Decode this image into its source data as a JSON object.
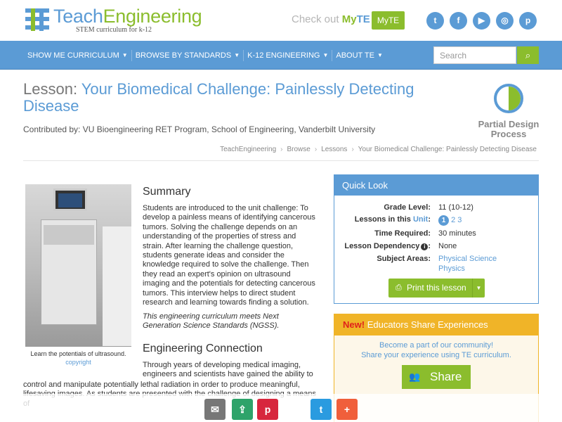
{
  "brand": {
    "name_part1": "Teach",
    "name_part2": "Engineering",
    "tagline": "STEM curriculum for k-12",
    "blue": "#5b9bd5",
    "green": "#8bbd2d"
  },
  "header": {
    "checkout_text": "Check out",
    "my": "My",
    "te": "TE",
    "myte_button": "MyTE",
    "social_icons": [
      "twitter-icon",
      "facebook-icon",
      "youtube-icon",
      "instagram-icon",
      "pinterest-icon"
    ],
    "social_glyphs": [
      "t",
      "f",
      "▶",
      "◎",
      "p"
    ]
  },
  "nav": {
    "items": [
      "SHOW ME CURRICULUM",
      "BROWSE BY STANDARDS",
      "K-12 ENGINEERING",
      "ABOUT TE"
    ],
    "search_placeholder": "Search",
    "search_glyph": "⌕"
  },
  "lesson": {
    "prefix": "Lesson:",
    "title": "Your Biomedical Challenge: Painlessly Detecting Disease",
    "contributed": "Contributed by: VU Bioengineering RET Program, School of Engineering, Vanderbilt University",
    "design_label": "Partial Design Process"
  },
  "breadcrumb": [
    "TeachEngineering",
    "Browse",
    "Lessons",
    "Your Biomedical Challenge: Painlessly Detecting Disease"
  ],
  "photo": {
    "caption": "Learn the potentials of ultrasound.",
    "copyright": "copyright"
  },
  "summary": {
    "heading": "Summary",
    "text": "Students are introduced to the unit challenge: To develop a painless means of identifying cancerous tumors. Solving the challenge depends on an understanding of the properties of stress and strain. After learning the challenge question, students generate ideas and consider the knowledge required to solve the challenge. Then they read an expert's opinion on ultrasound imaging and the potentials for detecting cancerous tumors. This interview helps to direct student research and learning towards finding a solution.",
    "ngss": "This engineering curriculum meets Next Generation Science Standards (NGSS)."
  },
  "engineering": {
    "heading": "Engineering Connection",
    "text1": "Through years of developing medical imaging, engineers and scientists have gained the ability to",
    "text2": "control and manipulate potentially lethal radiation in order to produce meaningful, lifesaving images. As students are presented with the challenge of designing a means of"
  },
  "quick_look": {
    "heading": "Quick Look",
    "grade_label": "Grade Level:",
    "grade_value": "11 (10-12)",
    "lessons_label_a": "Lessons in this",
    "lessons_label_b": "Unit",
    "lessons_label_c": ":",
    "lesson_current": "1",
    "lesson_other": "2 3",
    "time_label": "Time Required:",
    "time_value": "30 minutes",
    "dependency_label": "Lesson Dependency",
    "dependency_value": "None",
    "subject_label": "Subject Areas:",
    "subjects": [
      "Physical Science",
      "Physics"
    ],
    "print_label": "Print this lesson",
    "print_glyph": "⎙",
    "dd_glyph": "▼",
    "info_glyph": "i"
  },
  "share_box": {
    "new": "New!",
    "heading": "Educators Share Experiences",
    "line1": "Become a part of our community!",
    "line2": "Share your experience using TE curriculum.",
    "button": "Share",
    "button_glyph": "👥"
  },
  "floatbar": {
    "buttons": [
      {
        "name": "email-share-icon",
        "glyph": "✉",
        "color": "#777777"
      },
      {
        "name": "share-icon",
        "glyph": "⇪",
        "color": "#2ea36a"
      },
      {
        "name": "pinterest-share-icon",
        "glyph": "p",
        "color": "#d7263d"
      },
      {
        "name": "twitter-share-icon",
        "glyph": "t",
        "color": "#2a9be0"
      },
      {
        "name": "more-share-icon",
        "glyph": "+",
        "color": "#f05f3b"
      }
    ]
  }
}
